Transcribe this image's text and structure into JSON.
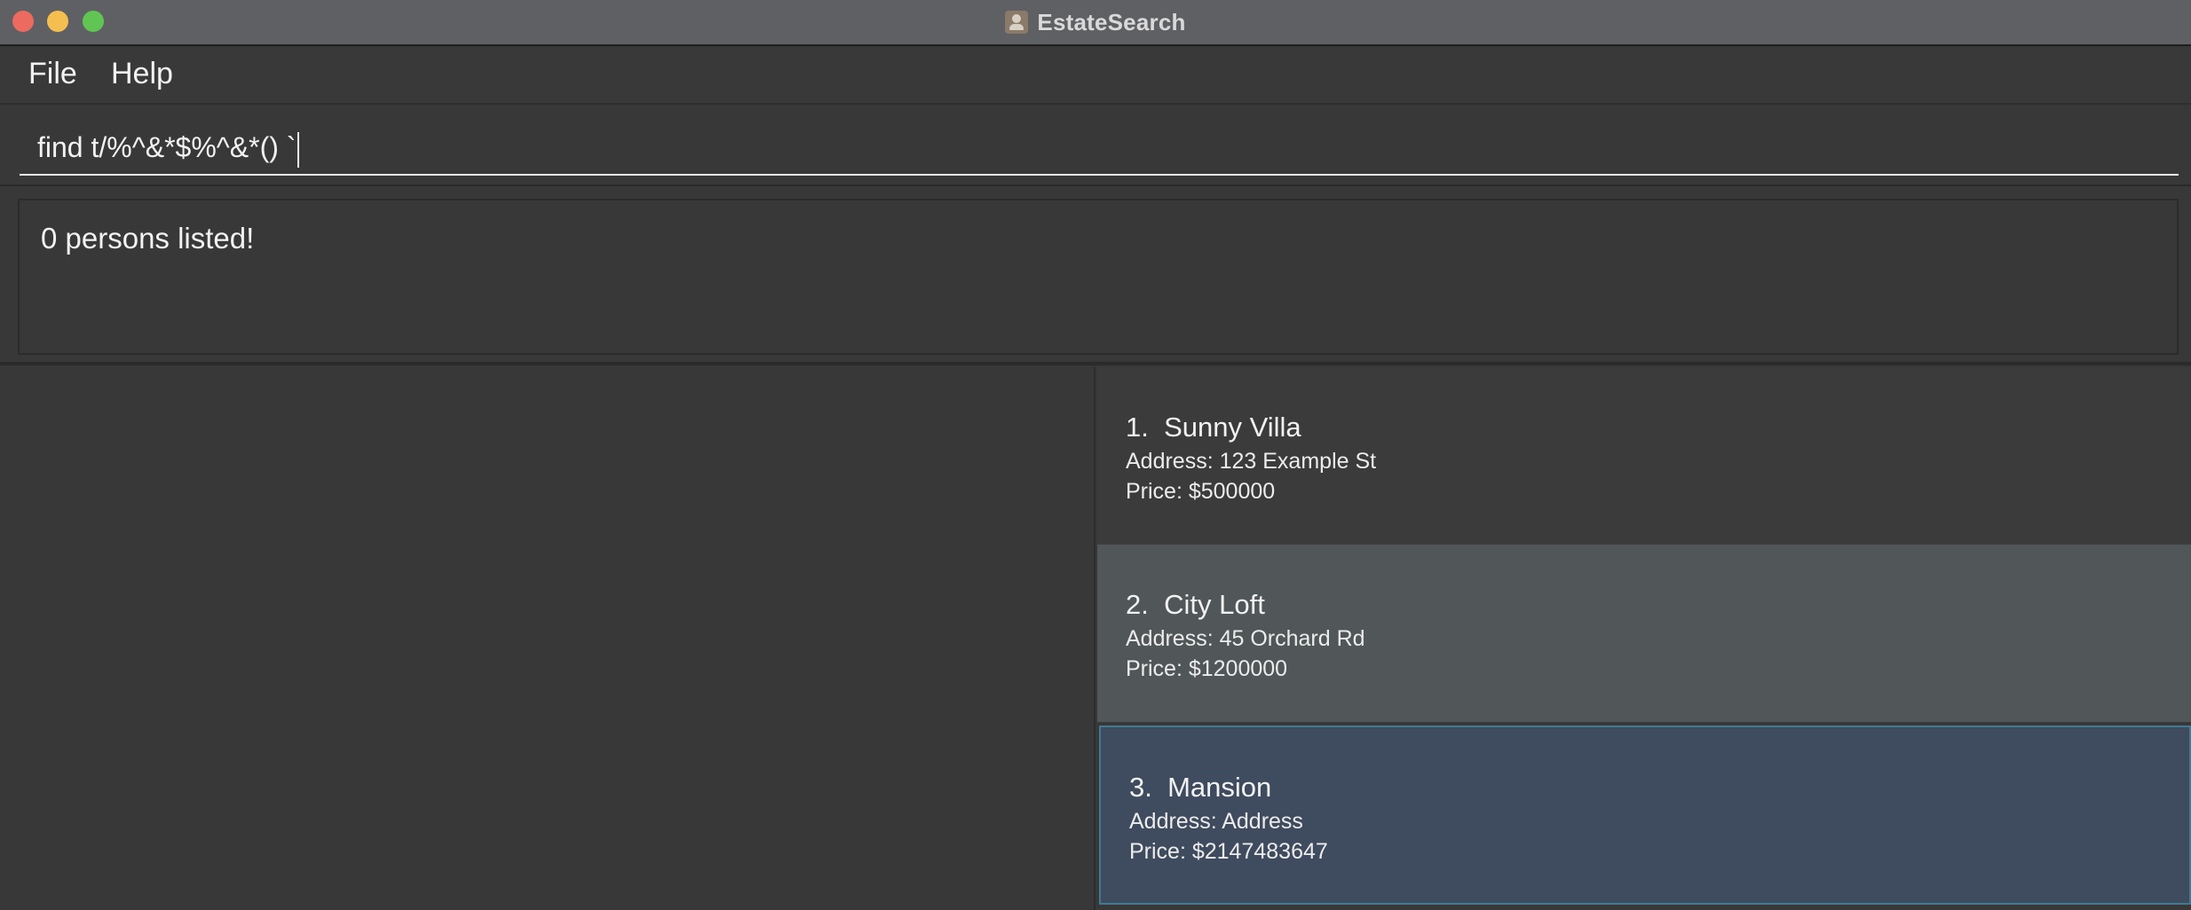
{
  "window": {
    "title": "EstateSearch",
    "icon": "app-person-icon"
  },
  "menu": {
    "file_label": "File",
    "help_label": "Help"
  },
  "command": {
    "value": "find t/%^&*$%^&*() `"
  },
  "result": {
    "message": "0 persons listed!"
  },
  "properties": [
    {
      "index": "1.",
      "name": "Sunny Villa",
      "address": "Address: 123 Example St",
      "price": "Price: $500000"
    },
    {
      "index": "2.",
      "name": "City Loft",
      "address": "Address: 45 Orchard Rd",
      "price": "Price: $1200000"
    },
    {
      "index": "3.",
      "name": "Mansion",
      "address": "Address: Address",
      "price": "Price: $2147483647"
    }
  ],
  "colors": {
    "titlebar": "#5f6064",
    "background": "#383838",
    "hover_card": "#515658",
    "selected_card": "#3f4b5e",
    "selected_border": "#3e7a93"
  }
}
